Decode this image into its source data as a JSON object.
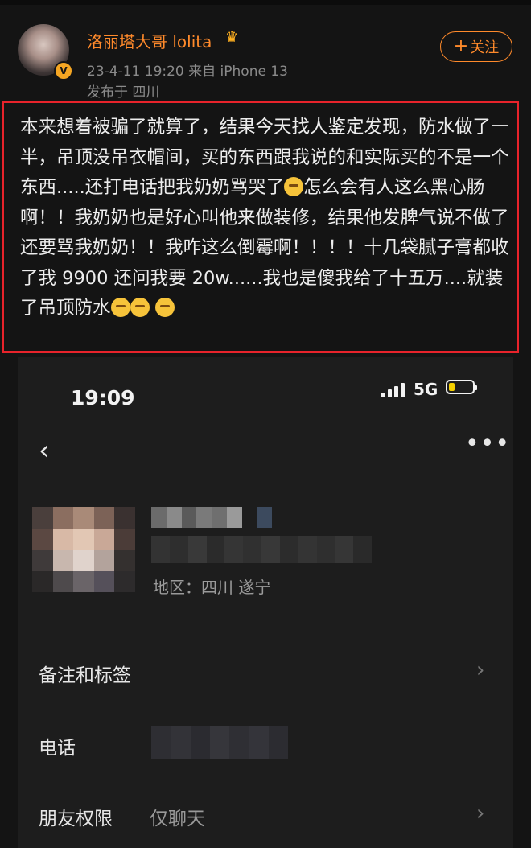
{
  "post": {
    "username": "洛丽塔大哥 lolita",
    "crown_icon": "crown-icon",
    "meta": "23-4-11 19:20  来自 iPhone 13",
    "location": "发布于 四川",
    "follow_label": "关注",
    "text_parts": [
      "本来想着被骗了就算了，结果今天找人鉴定发现，防水做了一半，吊顶没吊衣帽间，买的东西跟我说的和实际买的不是一个东西.....还打电话把我奶奶骂哭了",
      "怎么会有人这么黑心肠啊！！我奶奶也是好心叫他来做装修，结果他发脾气说不做了还要骂我奶奶！！我咋这么倒霉啊！！！！十几袋腻子膏都收了我 9900 还问我要 20w......我也是傻我给了十五万....就装了吊顶防水"
    ],
    "highlight_color": "#e8232b"
  },
  "screenshot": {
    "time": "19:09",
    "network": "5G",
    "region": "地区：四川  遂宁",
    "rows": [
      {
        "label": "备注和标签",
        "value": ""
      },
      {
        "label": "电话",
        "value": ""
      },
      {
        "label": "朋友权限",
        "value": "仅聊天"
      }
    ]
  }
}
